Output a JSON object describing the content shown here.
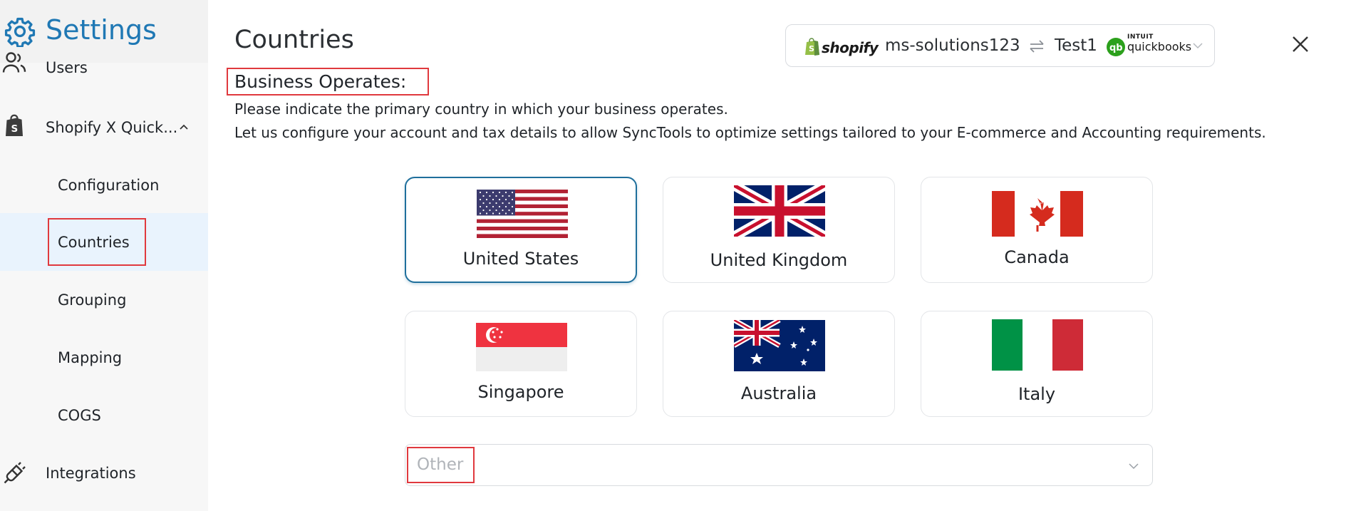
{
  "sidebar": {
    "title": "Settings",
    "items": [
      {
        "label": "Users",
        "icon": "users-icon"
      },
      {
        "label": "Shopify X Quick...",
        "icon": "shopify-bag-icon"
      },
      {
        "label": "Configuration"
      },
      {
        "label": "Countries"
      },
      {
        "label": "Grouping"
      },
      {
        "label": "Mapping"
      },
      {
        "label": "COGS"
      },
      {
        "label": "Integrations",
        "icon": "plug-icon"
      }
    ]
  },
  "main": {
    "title": "Countries",
    "section_title": "Business Operates:",
    "desc_line1": "Please indicate the primary country in which your business operates.",
    "desc_line2": "Let us configure your account and tax details to allow SyncTools to optimize settings tailored to your E-commerce and Accounting requirements."
  },
  "connection": {
    "shopify_label": "shopify",
    "store": "ms-solutions123",
    "company": "Test1",
    "qb_brand_top": "INTUIT",
    "qb_brand_bottom": "quickbooks"
  },
  "countries": [
    {
      "name": "United States",
      "selected": true
    },
    {
      "name": "United Kingdom",
      "selected": false
    },
    {
      "name": "Canada",
      "selected": false
    },
    {
      "name": "Singapore",
      "selected": false
    },
    {
      "name": "Australia",
      "selected": false
    },
    {
      "name": "Italy",
      "selected": false
    }
  ],
  "other_select": {
    "placeholder": "Other"
  },
  "colors": {
    "accent": "#1f78b4",
    "selected_border": "#1f6f9c",
    "highlight_box": "#e0393e",
    "active_item_bg": "#e9f3fd"
  }
}
